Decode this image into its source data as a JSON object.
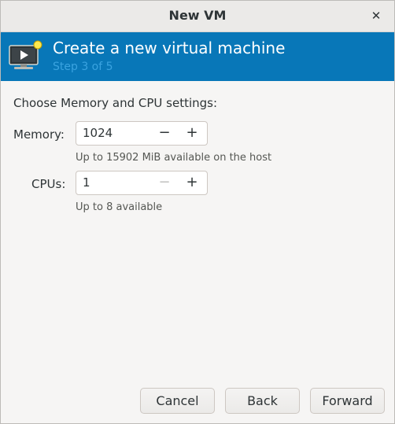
{
  "window": {
    "title": "New VM",
    "close_glyph": "✕"
  },
  "banner": {
    "icon": "vm-display-icon",
    "title": "Create a new virtual machine",
    "step": "Step 3 of 5",
    "bg_color": "#0877b8"
  },
  "main": {
    "heading": "Choose Memory and CPU settings:",
    "memory": {
      "label": "Memory:",
      "value": "1024",
      "minus": "−",
      "plus": "+",
      "hint": "Up to 15902 MiB available on the host"
    },
    "cpus": {
      "label": "CPUs:",
      "value": "1",
      "minus": "−",
      "plus": "+",
      "hint": "Up to 8 available"
    }
  },
  "footer": {
    "cancel": "Cancel",
    "back": "Back",
    "forward": "Forward"
  }
}
